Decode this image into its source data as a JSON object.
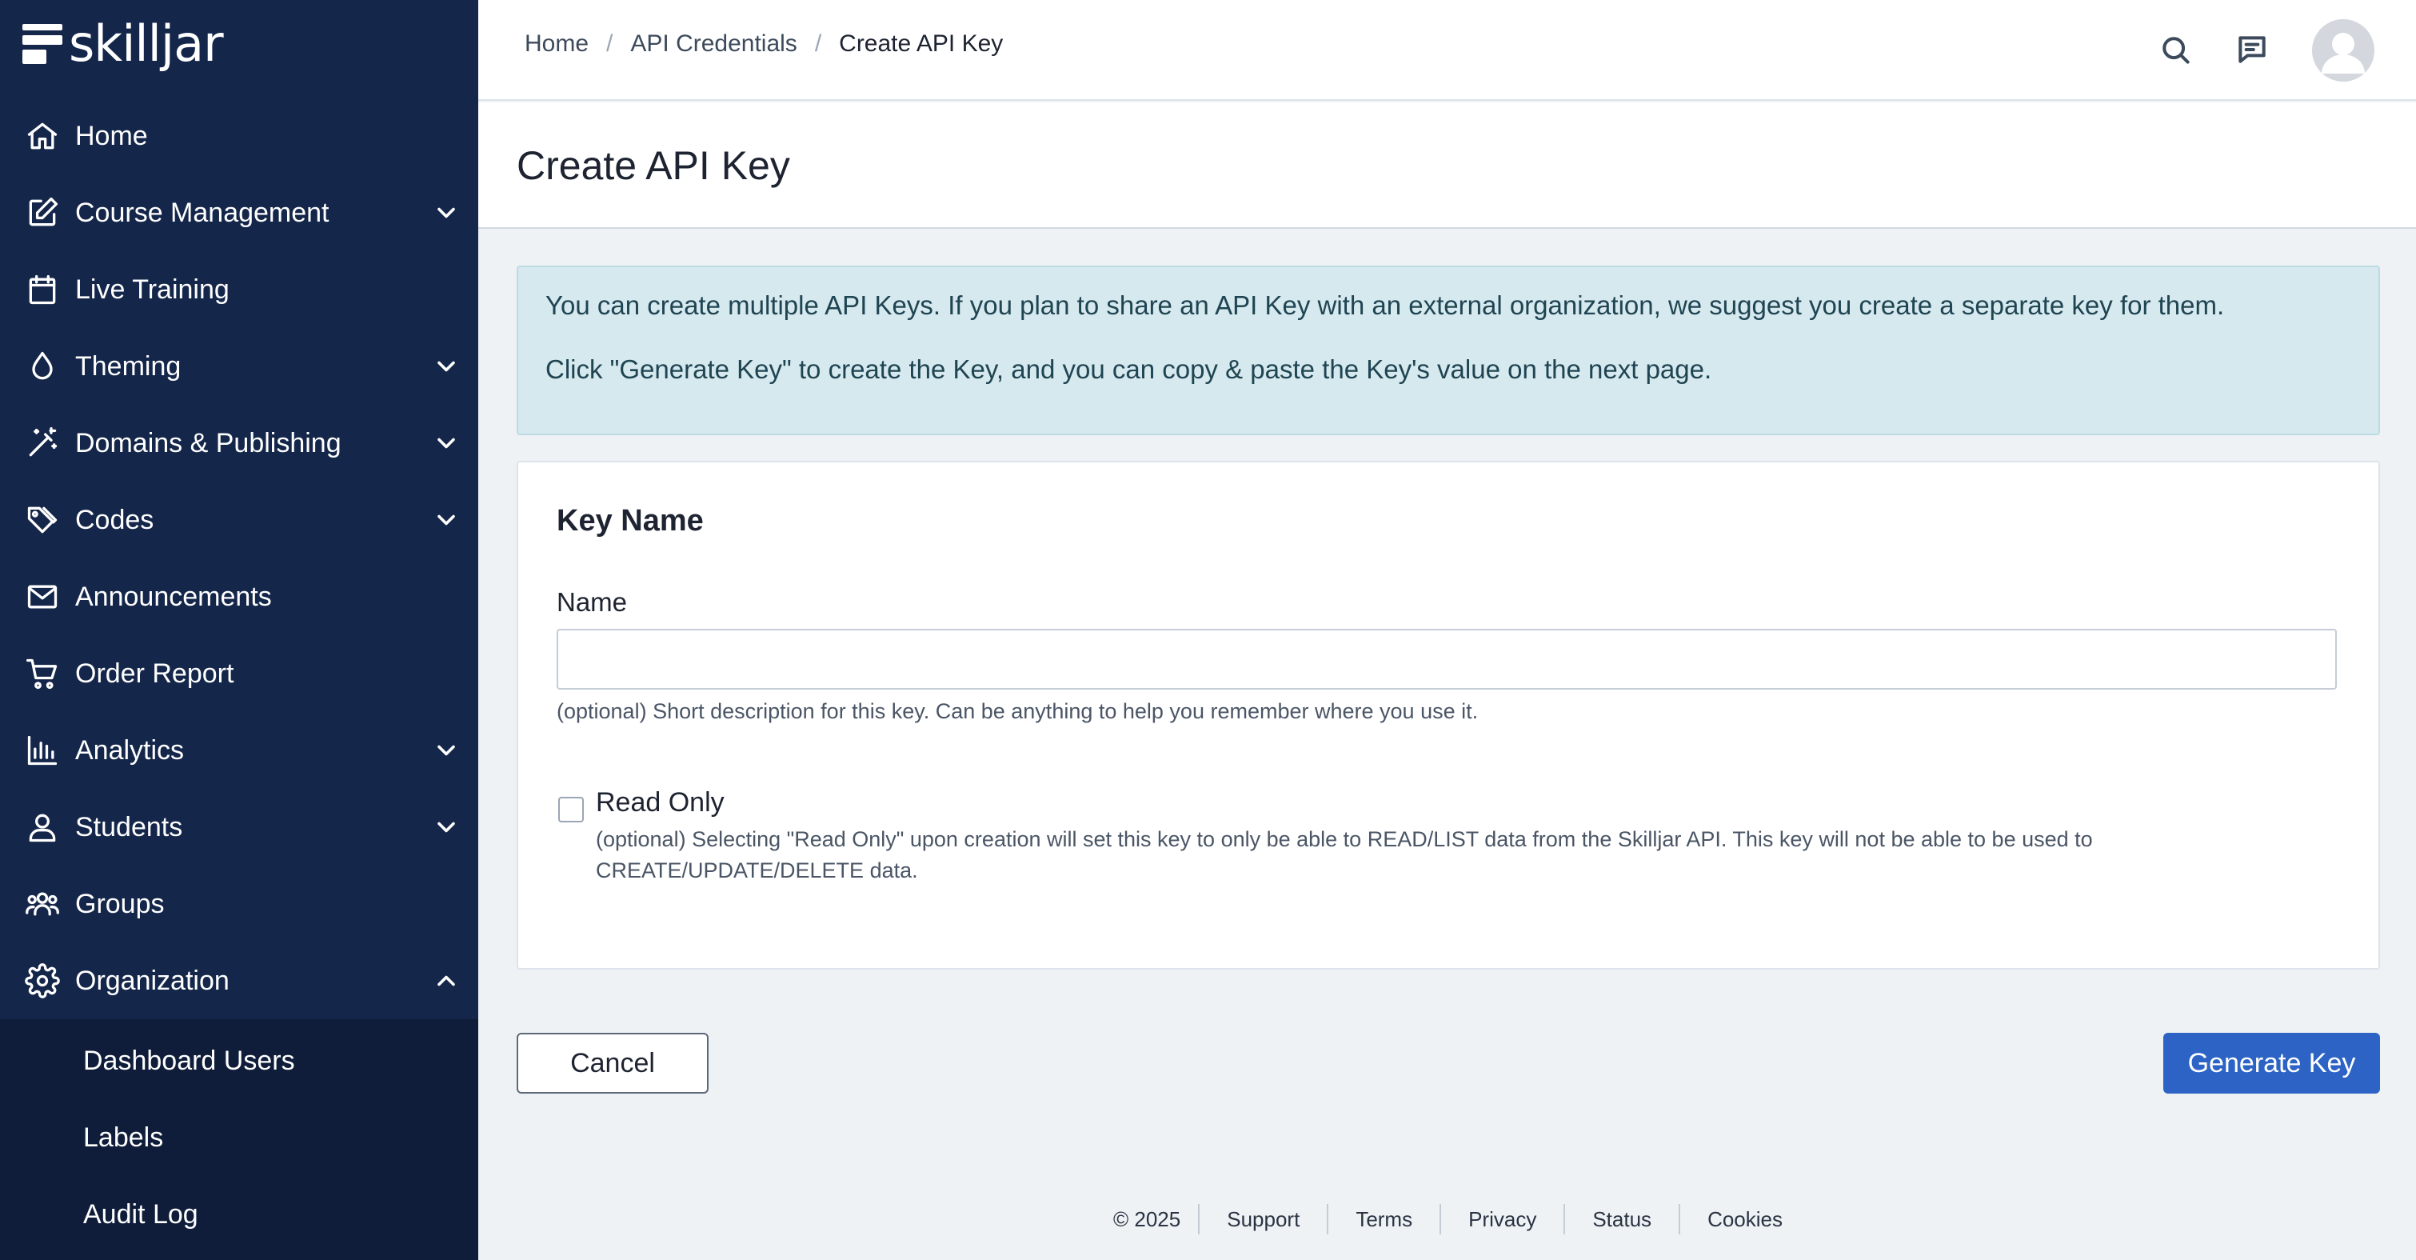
{
  "brand": {
    "name": "skilljar"
  },
  "sidebar": {
    "items": [
      {
        "label": "Home",
        "icon": "home-icon",
        "has_chevron": false
      },
      {
        "label": "Course Management",
        "icon": "edit-icon",
        "has_chevron": true
      },
      {
        "label": "Live Training",
        "icon": "calendar-icon",
        "has_chevron": false
      },
      {
        "label": "Theming",
        "icon": "droplet-icon",
        "has_chevron": true
      },
      {
        "label": "Domains & Publishing",
        "icon": "magic-wand-icon",
        "has_chevron": true
      },
      {
        "label": "Codes",
        "icon": "tags-icon",
        "has_chevron": true
      },
      {
        "label": "Announcements",
        "icon": "mail-icon",
        "has_chevron": false
      },
      {
        "label": "Order Report",
        "icon": "cart-icon",
        "has_chevron": false
      },
      {
        "label": "Analytics",
        "icon": "bar-chart-icon",
        "has_chevron": true
      },
      {
        "label": "Students",
        "icon": "user-icon",
        "has_chevron": true
      },
      {
        "label": "Groups",
        "icon": "users-icon",
        "has_chevron": false
      },
      {
        "label": "Organization",
        "icon": "gear-icon",
        "has_chevron": true,
        "expanded": true
      }
    ],
    "subitems": [
      {
        "label": "Dashboard Users"
      },
      {
        "label": "Labels"
      },
      {
        "label": "Audit Log"
      }
    ]
  },
  "header": {
    "breadcrumb": [
      {
        "label": "Home"
      },
      {
        "label": "API Credentials"
      },
      {
        "label": "Create API Key"
      }
    ],
    "separator": "/",
    "icons": [
      "search-icon",
      "chat-icon",
      "avatar"
    ]
  },
  "page": {
    "title": "Create API Key",
    "alert": {
      "line1": "You can create multiple API Keys. If you plan to share an API Key with an external organization, we suggest you create a separate key for them.",
      "line2": "Click \"Generate Key\" to create the Key, and you can copy & paste the Key's value on the next page."
    },
    "card": {
      "title": "Key Name",
      "name_label": "Name",
      "name_value": "",
      "name_help": "(optional) Short description for this key. Can be anything to help you remember where you use it.",
      "read_only_label": "Read Only",
      "read_only_checked": false,
      "read_only_help": "(optional) Selecting \"Read Only\" upon creation will set this key to only be able to READ/LIST data from the Skilljar API. This key will not be able to be used to CREATE/UPDATE/DELETE data."
    },
    "buttons": {
      "cancel": "Cancel",
      "generate": "Generate Key"
    },
    "colors": {
      "sidebar_bg": "#14264a",
      "primary_button": "#2c63c4",
      "alert_bg": "#d6e9ee"
    }
  },
  "footer": {
    "copyright": "© 2025",
    "links": [
      "Support",
      "Terms",
      "Privacy",
      "Status",
      "Cookies"
    ]
  }
}
